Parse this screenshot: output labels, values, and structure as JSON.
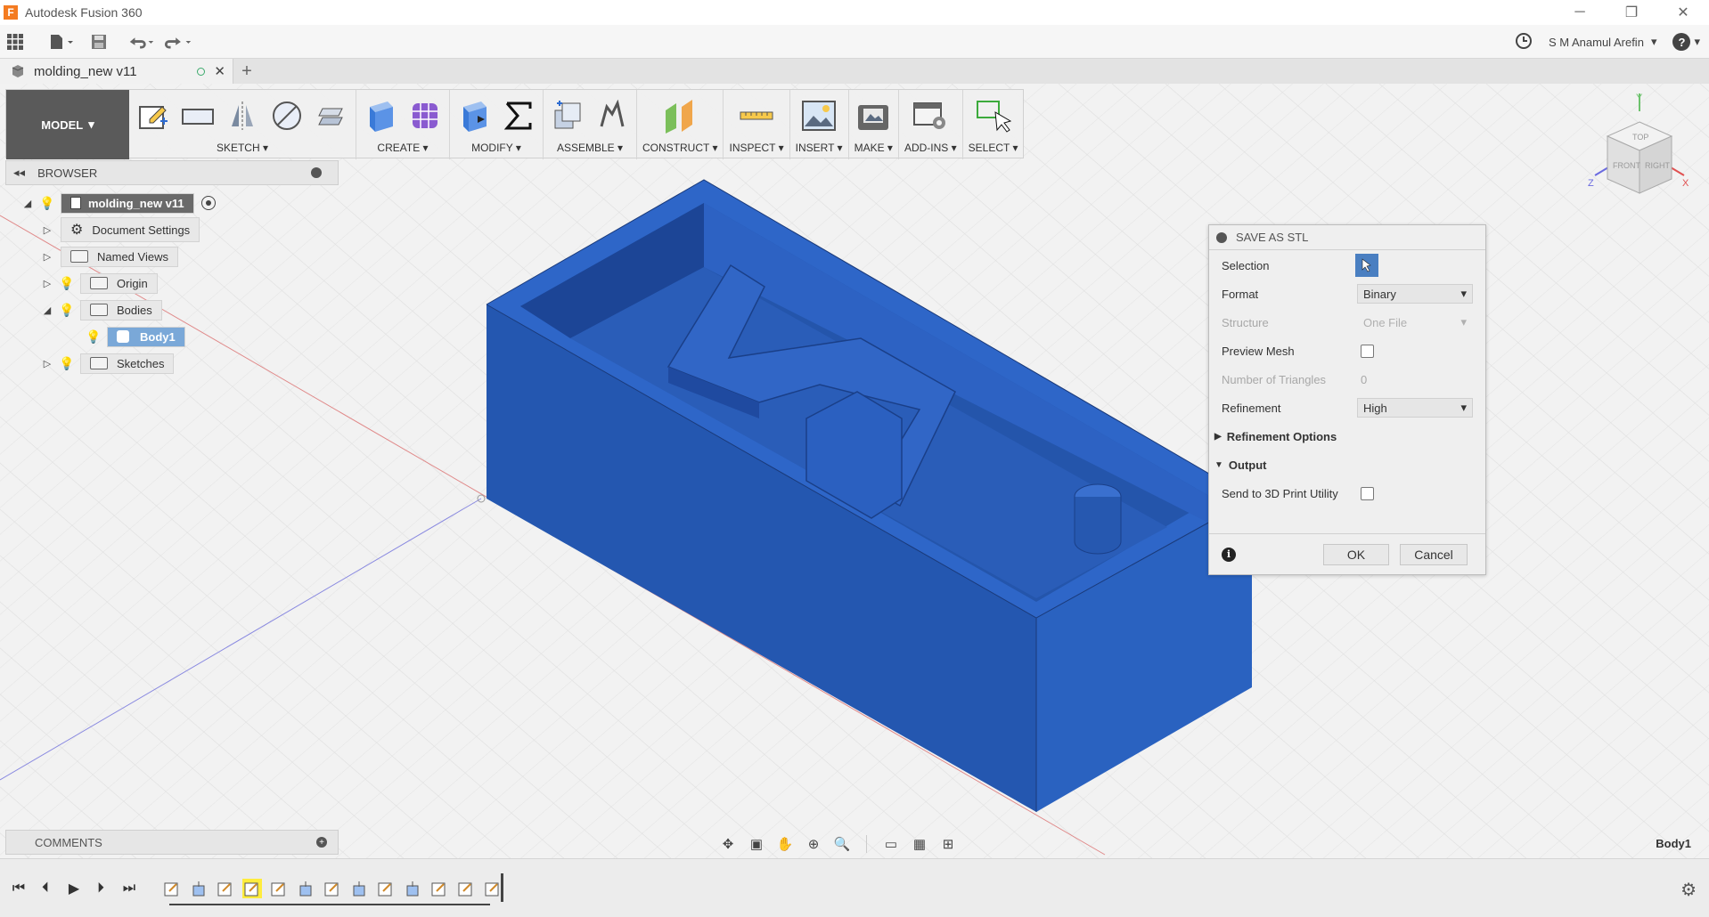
{
  "window": {
    "app_title": "Autodesk Fusion 360",
    "minimize": "─",
    "restore": "❐",
    "close": "✕"
  },
  "toolbar": {
    "user_name": "S M Anamul Arefin",
    "help": "?"
  },
  "tab": {
    "label": "molding_new v11",
    "close": "✕",
    "add": "+"
  },
  "ribbon": {
    "workspace": "MODEL",
    "groups": [
      "SKETCH",
      "CREATE",
      "MODIFY",
      "ASSEMBLE",
      "CONSTRUCT",
      "INSPECT",
      "INSERT",
      "MAKE",
      "ADD-INS",
      "SELECT"
    ]
  },
  "browser": {
    "title": "BROWSER",
    "root": "molding_new v11",
    "items": {
      "document_settings": "Document Settings",
      "named_views": "Named Views",
      "origin": "Origin",
      "bodies": "Bodies",
      "body1": "Body1",
      "sketches": "Sketches"
    }
  },
  "dialog": {
    "title": "SAVE AS STL",
    "selection_label": "Selection",
    "format_label": "Format",
    "format_value": "Binary",
    "structure_label": "Structure",
    "structure_value": "One File",
    "preview_mesh_label": "Preview Mesh",
    "num_triangles_label": "Number of Triangles",
    "num_triangles_value": "0",
    "refinement_label": "Refinement",
    "refinement_value": "High",
    "refinement_options": "Refinement Options",
    "output": "Output",
    "send_3d_print": "Send to 3D Print Utility",
    "ok": "OK",
    "cancel": "Cancel"
  },
  "comments": {
    "title": "COMMENTS"
  },
  "status": {
    "selection": "Body1"
  },
  "viewcube": {
    "top": "TOP",
    "front": "FRONT",
    "right": "RIGHT",
    "axis_x": "X",
    "axis_y": "Y",
    "axis_z": "Z"
  },
  "colors": {
    "body": "#2a5db8",
    "body_dark": "#1f4a9a",
    "accent_blue": "#4a7fc1",
    "timeline_highlight": "#ffec3d"
  }
}
